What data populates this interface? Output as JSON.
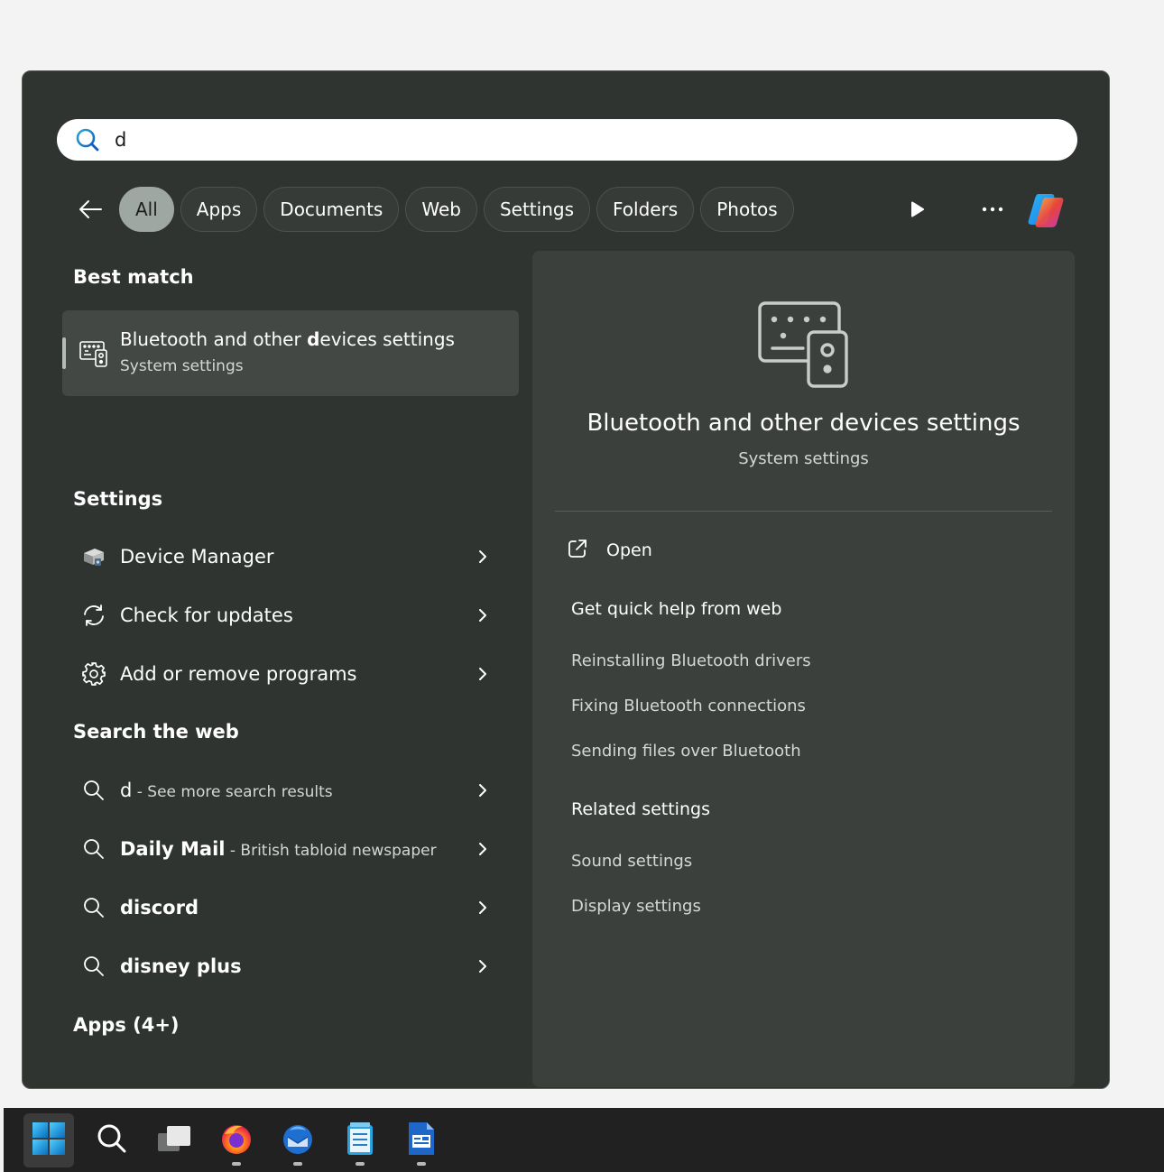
{
  "search": {
    "value": "d"
  },
  "filters": {
    "chips": [
      "All",
      "Apps",
      "Documents",
      "Web",
      "Settings",
      "Folders",
      "Photos"
    ],
    "active": "All"
  },
  "best_match": {
    "heading": "Best match",
    "title_pre": "Bluetooth and other ",
    "title_bold": "d",
    "title_post": "evices settings",
    "subtitle": "System settings"
  },
  "settings_section": {
    "heading": "Settings",
    "items": [
      {
        "label": "Device Manager",
        "icon": "device-manager-icon"
      },
      {
        "label": "Check for updates",
        "icon": "sync-icon"
      },
      {
        "label": "Add or remove programs",
        "icon": "gear-icon"
      }
    ]
  },
  "web_section": {
    "heading": "Search the web",
    "items": [
      {
        "label": "d",
        "suffix": " - See more search results"
      },
      {
        "label": "Daily Mail",
        "suffix": " - British tabloid newspaper"
      },
      {
        "label": "discord",
        "suffix": ""
      },
      {
        "label": "disney plus",
        "suffix": ""
      }
    ]
  },
  "apps_section": {
    "heading": "Apps (4+)"
  },
  "preview": {
    "title": "Bluetooth and other devices settings",
    "subtitle": "System settings",
    "open_label": "Open",
    "quick_help_heading": "Get quick help from web",
    "quick_help_links": [
      "Reinstalling Bluetooth drivers",
      "Fixing Bluetooth connections",
      "Sending files over Bluetooth"
    ],
    "related_heading": "Related settings",
    "related_links": [
      "Sound settings",
      "Display settings"
    ]
  },
  "taskbar": {
    "items": [
      "start-icon",
      "search-icon",
      "task-view-icon",
      "firefox-icon",
      "thunderbird-icon",
      "notepad-icon",
      "writer-icon"
    ]
  },
  "colors": {
    "panel_bg": "#2f3431",
    "preview_bg": "#3b403c",
    "active_chip": "#9fa7a2",
    "taskbar_bg": "#202120",
    "accent_blue": "#0a6cbd"
  }
}
